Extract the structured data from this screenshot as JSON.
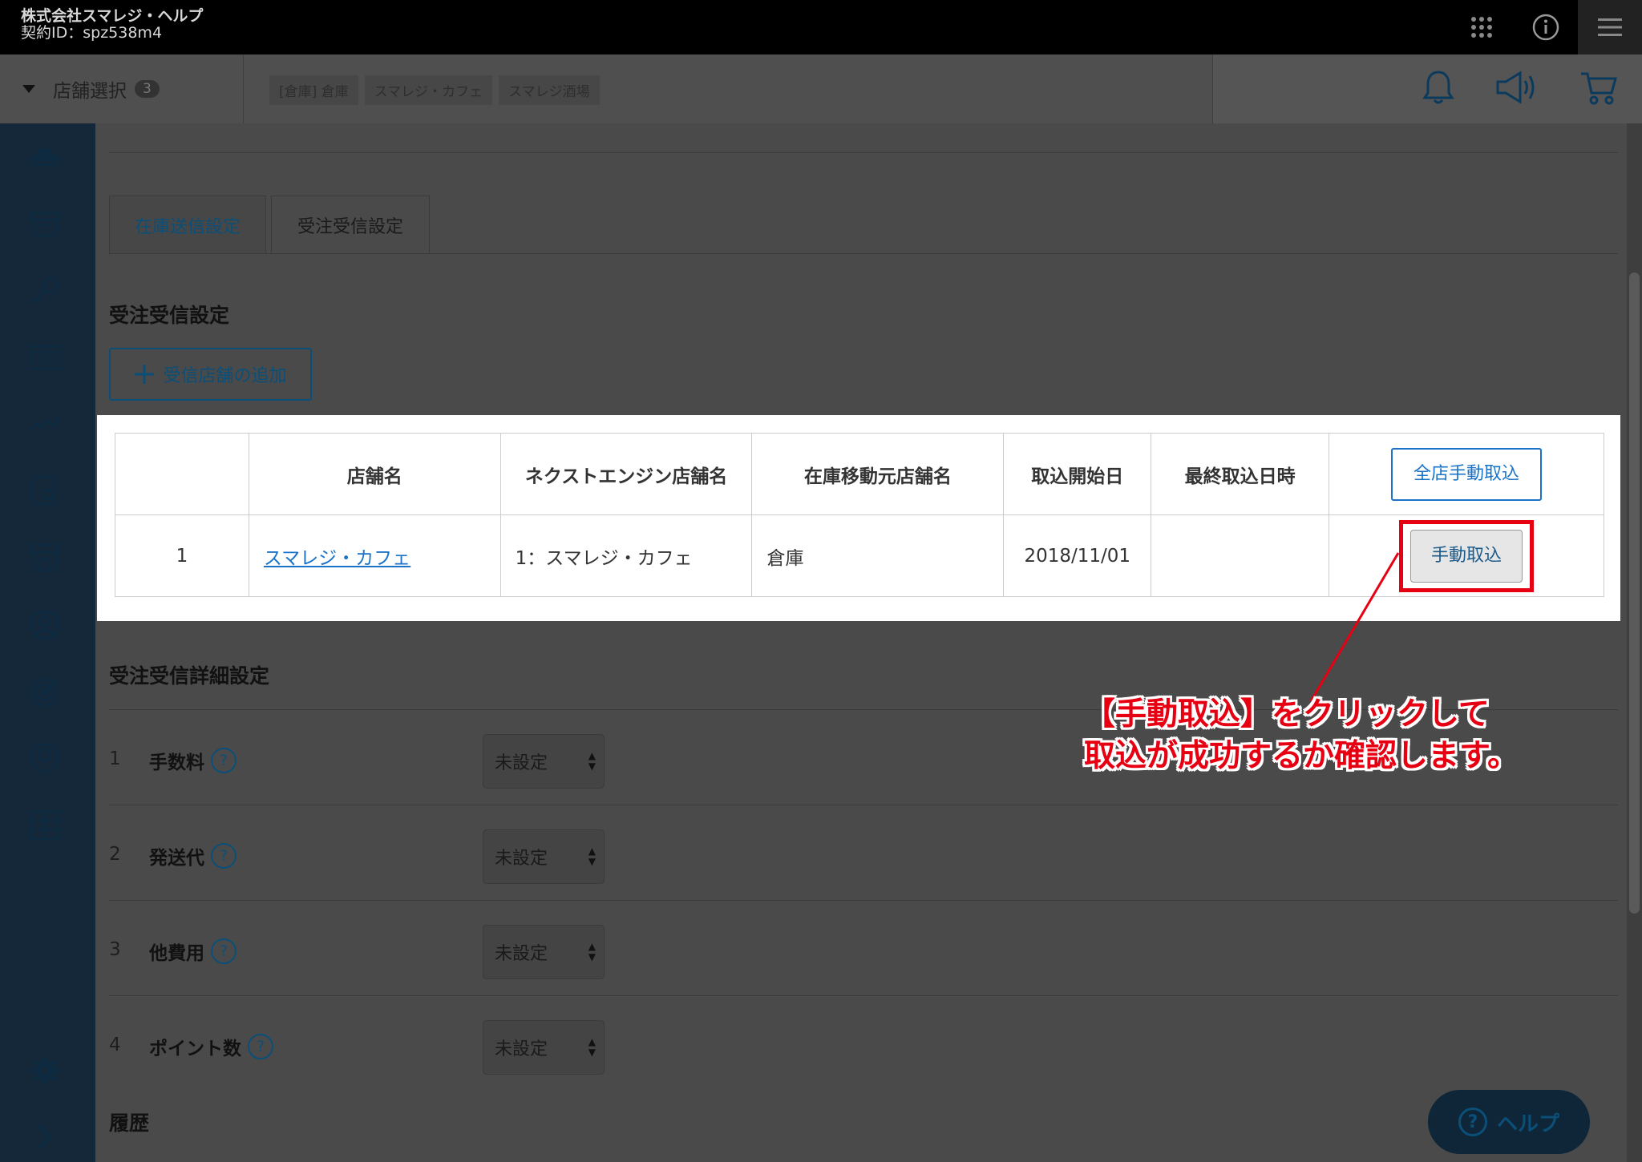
{
  "header": {
    "company_name": "株式会社スマレジ・ヘルプ",
    "contract_id": "契約ID：spz538m4",
    "icons": [
      "apps-grid-icon",
      "info-icon",
      "hamburger-menu-icon"
    ]
  },
  "store_bar": {
    "select_label": "店舗選択",
    "select_count": "3",
    "stores": [
      "[倉庫] 倉庫",
      "スマレジ・カフェ",
      "スマレジ酒場"
    ],
    "icons": [
      "bell-icon",
      "megaphone-icon",
      "cart-icon"
    ]
  },
  "sidebar": {
    "items": [
      "cloud-icon",
      "archive-box-icon",
      "key-icon",
      "book-icon",
      "chart-line-icon",
      "report-search-icon",
      "store-icon",
      "user-circle-icon",
      "target-icon",
      "user-icon",
      "grid-table-icon"
    ],
    "bottom": [
      "gear-icon",
      "expand-chevron-icon"
    ]
  },
  "tabs": [
    {
      "label": "在庫送信設定"
    },
    {
      "label": "受注受信設定"
    }
  ],
  "order_receive": {
    "title": "受注受信設定",
    "add_button": "受信店舗の追加",
    "columns": [
      "店舗名",
      "ネクストエンジン店舗名",
      "在庫移動元店舗名",
      "取込開始日",
      "最終取込日時"
    ],
    "all_import_button": "全店手動取込",
    "rows": [
      {
        "num": "1",
        "store": "スマレジ・カフェ",
        "ne_store": "1：スマレジ・カフェ",
        "source_store": "倉庫",
        "start_date": "2018/11/01",
        "last_import": "",
        "action": "手動取込"
      }
    ]
  },
  "detail_settings": {
    "title": "受注受信詳細設定",
    "rows": [
      {
        "num": "1",
        "label": "手数料",
        "value": "未設定"
      },
      {
        "num": "2",
        "label": "発送代",
        "value": "未設定"
      },
      {
        "num": "3",
        "label": "他費用",
        "value": "未設定"
      },
      {
        "num": "4",
        "label": "ポイント数",
        "value": "未設定"
      }
    ]
  },
  "history": {
    "title": "履歴"
  },
  "help_button": {
    "label": "ヘルプ"
  },
  "annotation": {
    "line1": "【手動取込】をクリックして",
    "line2": "取込が成功するか確認します。",
    "color": "#e60012"
  }
}
